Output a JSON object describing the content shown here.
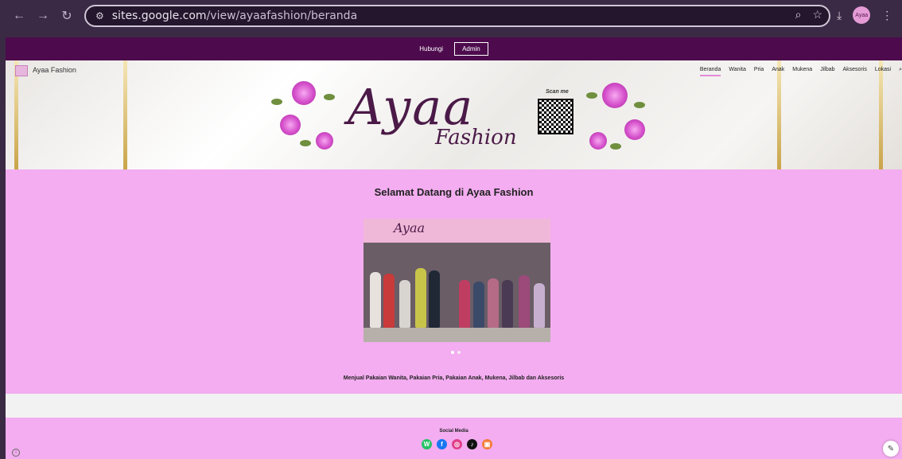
{
  "browser": {
    "back_icon": "arrow-left-icon",
    "forward_icon": "arrow-right-icon",
    "reload_icon": "reload-icon",
    "url_host": "sites.google.com",
    "url_path": "/view/ayaafashion/beranda"
  },
  "topbar": {
    "hubungi": "Hubungi",
    "admin": "Admin",
    "color": "#4d0b4d"
  },
  "header": {
    "site_name": "Ayaa Fashion",
    "brand_main": "Ayaa",
    "brand_sub": "Fashion",
    "scan_me": "Scan me",
    "nav": [
      "Beranda",
      "Wanita",
      "Pria",
      "Anak",
      "Mukena",
      "Jilbab",
      "Aksesoris",
      "Lokasi"
    ],
    "active_nav": "Beranda"
  },
  "main": {
    "title": "Selamat Datang di Ayaa Fashion",
    "sign_text": "Ayaa",
    "tagline": "Menjual Pakaian Wanita, Pakaian Pria, Pakaian Anak, Mukena, Jilbab dan Aksesoris",
    "background": "#f3adf0"
  },
  "footer": {
    "social_title": "Social Media",
    "socials": [
      {
        "name": "whatsapp-icon",
        "color": "#25c266",
        "glyph": "W"
      },
      {
        "name": "facebook-icon",
        "color": "#1877f2",
        "glyph": "f"
      },
      {
        "name": "instagram-icon",
        "color": "#e23f8a",
        "glyph": "◎"
      },
      {
        "name": "tiktok-icon",
        "color": "#111111",
        "glyph": "♪"
      },
      {
        "name": "shop-icon",
        "color": "#f27d3a",
        "glyph": "▣"
      }
    ]
  }
}
